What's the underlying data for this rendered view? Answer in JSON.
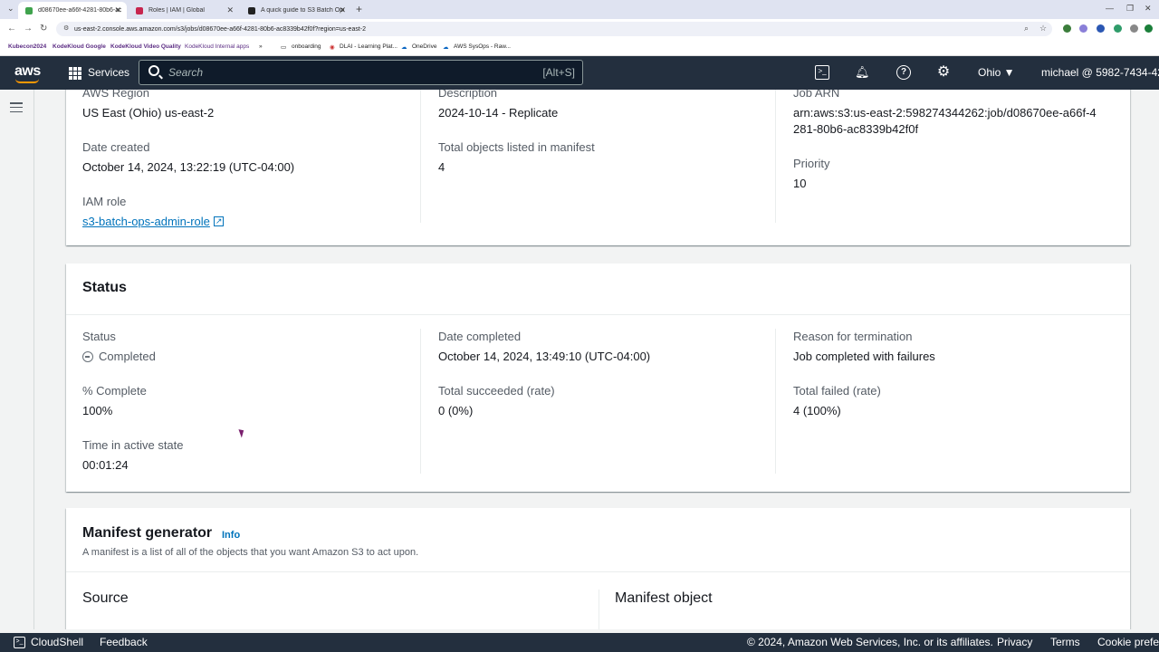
{
  "browser": {
    "tabs": [
      {
        "label": "d08670ee-a66f-4281-80b6-ac8",
        "favicon_color": "#3fa34d"
      },
      {
        "label": "Roles | IAM | Global",
        "favicon_color": "#c7254e"
      },
      {
        "label": "A quick guide to S3 Batch Ope",
        "favicon_color": "#222222"
      }
    ],
    "url": "us-east-2.console.aws.amazon.com/s3/jobs/d08670ee-a66f-4281-80b6-ac8339b42f0f?region=us-east-2",
    "bookmarks": [
      "Kubecon2024",
      "KodeKloud Google",
      "KodeKloud Video Quality",
      "KodeKloud Internal apps",
      "»",
      "onboarding",
      "DLAI - Learning Plat...",
      "OneDrive",
      "AWS SysOps - Raw..."
    ]
  },
  "aws_nav": {
    "logo": "aws",
    "services_label": "Services",
    "search_placeholder": "Search",
    "search_shortcut": "[Alt+S]",
    "region": "Ohio ▼",
    "account": "michael @ 5982-7434-42"
  },
  "job_details": {
    "col1": [
      {
        "label": "AWS Region",
        "value": "US East (Ohio) us-east-2"
      },
      {
        "label": "Date created",
        "value": "October 14, 2024, 13:22:19 (UTC-04:00)"
      },
      {
        "label": "IAM role",
        "value": "s3-batch-ops-admin-role"
      }
    ],
    "col2": [
      {
        "label": "Description",
        "value": "2024-10-14 - Replicate"
      },
      {
        "label": "Total objects listed in manifest",
        "value": "4"
      }
    ],
    "col3": [
      {
        "label": "Job ARN",
        "value": "arn:aws:s3:us-east-2:598274344262:job/d08670ee-a66f-4281-80b6-ac8339b42f0f"
      },
      {
        "label": "Priority",
        "value": "10"
      }
    ]
  },
  "status": {
    "title": "Status",
    "col1": [
      {
        "label": "Status",
        "value": "Completed"
      },
      {
        "label": "% Complete",
        "value": "100%"
      },
      {
        "label": "Time in active state",
        "value": "00:01:24"
      }
    ],
    "col2": [
      {
        "label": "Date completed",
        "value": "October 14, 2024, 13:49:10 (UTC-04:00)"
      },
      {
        "label": "Total succeeded (rate)",
        "value": "0 (0%)"
      }
    ],
    "col3": [
      {
        "label": "Reason for termination",
        "value": "Job completed with failures"
      },
      {
        "label": "Total failed (rate)",
        "value": "4 (100%)"
      }
    ]
  },
  "manifest_generator": {
    "title": "Manifest generator",
    "info": "Info",
    "description": "A manifest is a list of all of the objects that you want Amazon S3 to act upon.",
    "source_heading": "Source",
    "manifest_object_heading": "Manifest object"
  },
  "footer": {
    "cloudshell": "CloudShell",
    "feedback": "Feedback",
    "copyright": "© 2024, Amazon Web Services, Inc. or its affiliates.",
    "privacy": "Privacy",
    "terms": "Terms",
    "cookie": "Cookie prefer"
  },
  "colors": {
    "nav_bg": "#232f3e",
    "link": "#0073bb",
    "accent": "#ff9900"
  }
}
